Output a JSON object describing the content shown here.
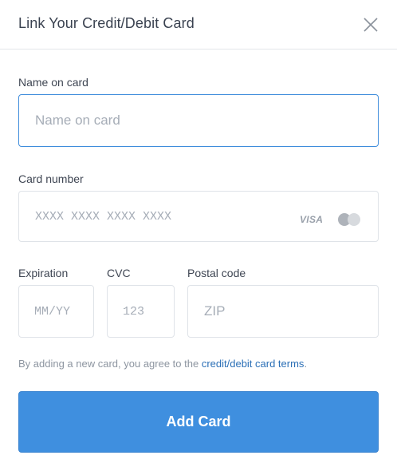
{
  "dialog": {
    "title": "Link Your Credit/Debit Card"
  },
  "close_icon": "close-icon",
  "name_on_card": {
    "label": "Name on card",
    "placeholder": "Name on card",
    "value": ""
  },
  "card_number": {
    "label": "Card number",
    "placeholder": "XXXX XXXX XXXX XXXX",
    "value": "",
    "brand_visa": "VISA",
    "brand_icon": "mastercard-icon"
  },
  "expiration": {
    "label": "Expiration",
    "placeholder": "MM/YY",
    "value": ""
  },
  "cvc": {
    "label": "CVC",
    "placeholder": "123",
    "value": ""
  },
  "postal_code": {
    "label": "Postal code",
    "placeholder": "ZIP",
    "value": ""
  },
  "terms": {
    "prefix": "By adding a new card, you agree to the ",
    "link": "credit/debit card terms",
    "suffix": "."
  },
  "submit": {
    "label": "Add Card"
  },
  "colors": {
    "accent": "#3f8fdf",
    "link": "#2b6fb6",
    "focus_border": "#3f8ddc",
    "border": "#dfe3e8"
  }
}
